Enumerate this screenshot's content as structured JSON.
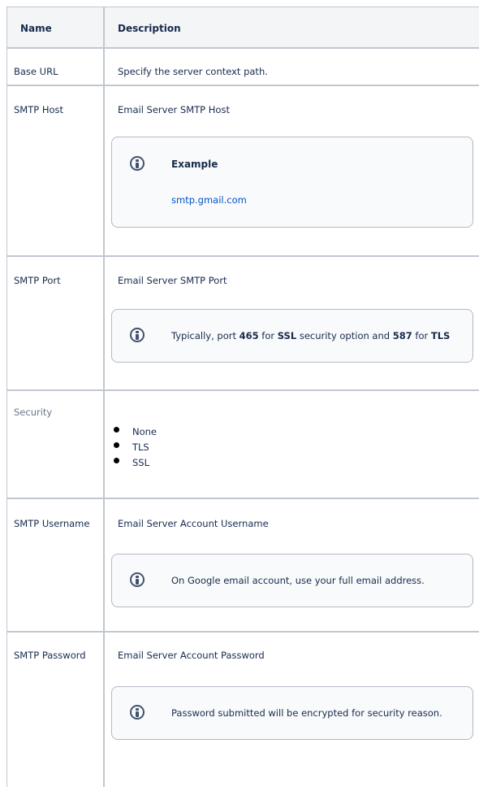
{
  "headers": {
    "name": "Name",
    "description": "Description"
  },
  "rows": {
    "base_url": {
      "name": "Base URL",
      "desc": "Specify the server context path."
    },
    "smtp_host": {
      "name": "SMTP Host",
      "desc": "Email Server SMTP Host",
      "panel": {
        "title": "Example",
        "link": "smtp.gmail.com"
      }
    },
    "smtp_port": {
      "name": "SMTP Port",
      "desc": "Email Server SMTP Port",
      "panel": {
        "t1": "Typically, port ",
        "b1": "465",
        "t2": " for ",
        "b2": "SSL",
        "t3": " security option and ",
        "b3": "587",
        "t4": " for ",
        "b4": "TLS"
      }
    },
    "security": {
      "name": "Security",
      "options": [
        "None",
        "TLS",
        "SSL"
      ]
    },
    "smtp_username": {
      "name": "SMTP Username",
      "desc": "Email Server Account Username",
      "panel": {
        "text": "On Google email account, use your full email address."
      }
    },
    "smtp_password": {
      "name": "SMTP Password",
      "desc": "Email Server Account Password",
      "panel": {
        "text": "Password submitted will be encrypted for security reason."
      }
    }
  },
  "colors": {
    "border": "#c1c7d0",
    "header_bg": "#f4f5f7",
    "panel_bg": "#f9fafb",
    "link": "#0052cc"
  },
  "icons": {
    "info": "info-icon"
  }
}
